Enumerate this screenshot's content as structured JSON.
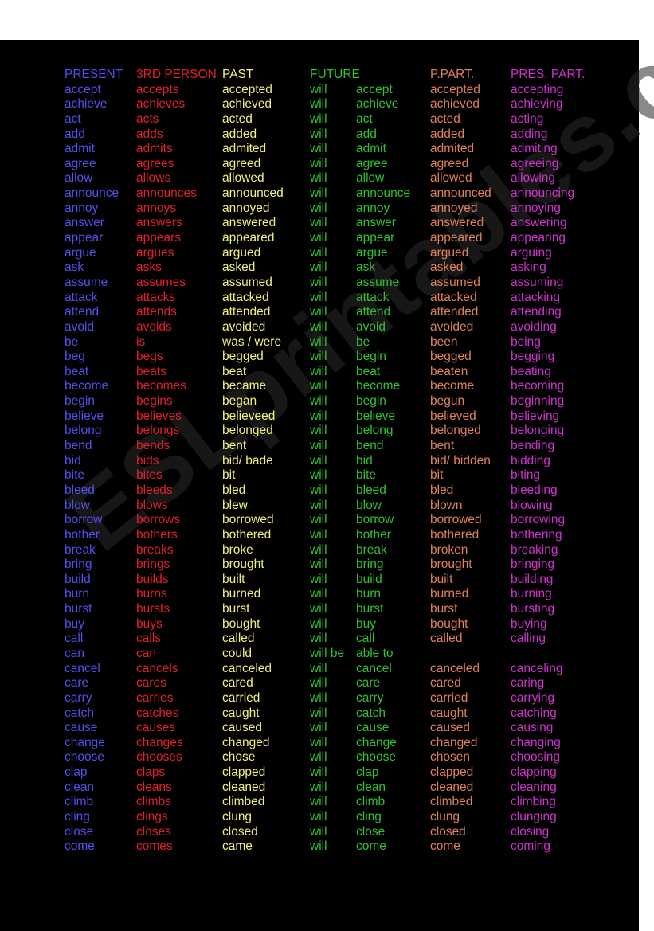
{
  "colors": {
    "present": "#5050ee",
    "third_person": "#e0202a",
    "past": "#f0f07a",
    "future": "#30c030",
    "past_participle": "#e0805a",
    "present_participle": "#cc33cc"
  },
  "watermark": "ESLprintables.com",
  "headers": [
    "PRESENT",
    "3RD PERSON",
    "PAST",
    "FUTURE",
    "P.PART.",
    "PRES. PART."
  ],
  "rows": [
    [
      "accept",
      "accepts",
      "accepted",
      "will",
      "accept",
      "accepted",
      "accepting"
    ],
    [
      "achieve",
      "achieves",
      "achieved",
      "will",
      "achieve",
      "achieved",
      "achieving"
    ],
    [
      "act",
      "acts",
      "acted",
      "will",
      "act",
      "acted",
      "acting"
    ],
    [
      "add",
      "adds",
      "added",
      "will",
      "add",
      "added",
      "adding"
    ],
    [
      "admit",
      "admits",
      "admited",
      "will",
      "admit",
      "admited",
      "admiting"
    ],
    [
      "agree",
      "agrees",
      "agreed",
      "will",
      "agree",
      "agreed",
      "agreeing"
    ],
    [
      "allow",
      "allows",
      "allowed",
      "will",
      "allow",
      "allowed",
      "allowing"
    ],
    [
      "announce",
      "announces",
      "announced",
      "will",
      "announce",
      "announced",
      "announcing"
    ],
    [
      "annoy",
      "annoys",
      "annoyed",
      "will",
      "annoy",
      "annoyed",
      "annoying"
    ],
    [
      "answer",
      "answers",
      "answered",
      "will",
      "answer",
      "answered",
      "answering"
    ],
    [
      "appear",
      "appears",
      "appeared",
      "will",
      "appear",
      "appeared",
      "appearing"
    ],
    [
      "argue",
      "argues",
      "argued",
      "will",
      "argue",
      "argued",
      "arguing"
    ],
    [
      "ask",
      "asks",
      "asked",
      "will",
      "ask",
      "asked",
      "asking"
    ],
    [
      "assume",
      "assumes",
      "assumed",
      "will",
      "assume",
      "assumed",
      "assuming"
    ],
    [
      "attack",
      "attacks",
      "attacked",
      "will",
      "attack",
      "attacked",
      "attacking"
    ],
    [
      "attend",
      "attends",
      "attended",
      "will",
      "attend",
      "attended",
      "attending"
    ],
    [
      "avoid",
      "avoids",
      "avoided",
      "will",
      "avoid",
      "avoided",
      "avoiding"
    ],
    [
      "be",
      "is",
      "was / were",
      "will",
      "be",
      "been",
      "being"
    ],
    [
      "beg",
      "begs",
      "begged",
      "will",
      "begin",
      "begged",
      "begging"
    ],
    [
      "beat",
      "beats",
      "beat",
      "will",
      "beat",
      "beaten",
      "beating"
    ],
    [
      "become",
      "becomes",
      "became",
      "will",
      "become",
      "become",
      "becoming"
    ],
    [
      "begin",
      "begins",
      "began",
      "will",
      "begin",
      "begun",
      "beginning"
    ],
    [
      "believe",
      "believes",
      "believeed",
      "will",
      "believe",
      "believed",
      "believing"
    ],
    [
      "belong",
      "belongs",
      "belonged",
      "will",
      "belong",
      "belonged",
      "belonging"
    ],
    [
      "bend",
      "bends",
      "bent",
      "will",
      "bend",
      "bent",
      "bending"
    ],
    [
      "bid",
      "bids",
      "bid/ bade",
      "will",
      "bid",
      "bid/ bidden",
      "bidding"
    ],
    [
      "bite",
      "bites",
      "bit",
      "will",
      "bite",
      "bit",
      "biting"
    ],
    [
      "bleed",
      "bleeds",
      "bled",
      "will",
      "bleed",
      "bled",
      "bleeding"
    ],
    [
      "blow",
      "blows",
      "blew",
      "will",
      "blow",
      "blown",
      "blowing"
    ],
    [
      "borrow",
      "borrows",
      "borrowed",
      "will",
      "borrow",
      "borrowed",
      "borrowing"
    ],
    [
      "bother",
      "bothers",
      "bothered",
      "will",
      "bother",
      "bothered",
      "bothering"
    ],
    [
      "break",
      "breaks",
      "broke",
      "will",
      "break",
      "broken",
      "breaking"
    ],
    [
      "bring",
      "brings",
      "brought",
      "will",
      "bring",
      "brought",
      "bringing"
    ],
    [
      "build",
      "builds",
      "built",
      "will",
      "build",
      "built",
      "building"
    ],
    [
      "burn",
      "burns",
      "burned",
      "will",
      "burn",
      "burned",
      "burning"
    ],
    [
      "burst",
      "bursts",
      "burst",
      "will",
      "burst",
      "burst",
      "bursting"
    ],
    [
      "buy",
      "buys",
      "bought",
      "will",
      "buy",
      "bought",
      "buying"
    ],
    [
      "call",
      "calls",
      "called",
      "will",
      "call",
      "called",
      "calling"
    ],
    [
      "can",
      "can",
      "could",
      "will be",
      "able to",
      "",
      ""
    ],
    [
      "cancel",
      "cancels",
      "canceled",
      "will",
      "cancel",
      "canceled",
      "canceling"
    ],
    [
      "care",
      "cares",
      "cared",
      "will",
      "care",
      "cared",
      "caring"
    ],
    [
      "carry",
      "carries",
      "carried",
      "will",
      "carry",
      "carried",
      "carrying"
    ],
    [
      "catch",
      "catches",
      "caught",
      "will",
      "catch",
      "caught",
      "catching"
    ],
    [
      "cause",
      "causes",
      "caused",
      "will",
      "cause",
      "caused",
      "causing"
    ],
    [
      "change",
      "changes",
      "changed",
      "will",
      "change",
      "changed",
      "changing"
    ],
    [
      "choose",
      "chooses",
      "chose",
      "will",
      "choose",
      "chosen",
      "choosing"
    ],
    [
      "clap",
      "claps",
      "clapped",
      "will",
      "clap",
      "clapped",
      "clapping"
    ],
    [
      "clean",
      "cleans",
      "cleaned",
      "will",
      "clean",
      "cleaned",
      "cleaning"
    ],
    [
      "climb",
      "climbs",
      "climbed",
      "will",
      "climb",
      "climbed",
      "climbing"
    ],
    [
      "cling",
      "clings",
      "clung",
      "will",
      "cling",
      "clung",
      "clunging"
    ],
    [
      "close",
      "closes",
      "closed",
      "will",
      "close",
      "closed",
      "closing"
    ],
    [
      "come",
      "comes",
      "came",
      "will",
      "come",
      "come",
      "coming"
    ]
  ]
}
